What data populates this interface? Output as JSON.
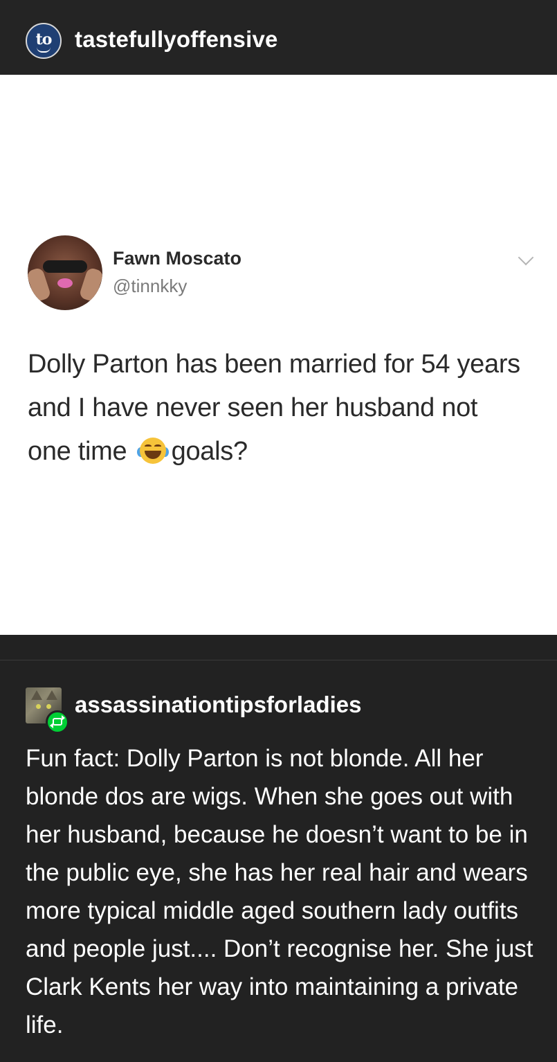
{
  "header": {
    "avatar_text": "to",
    "blog_name": "tastefullyoffensive"
  },
  "tweet": {
    "display_name": "Fawn Moscato",
    "handle": "@tinnkky",
    "text_before_emoji": "Dolly Parton has been married for 54 years and I have never seen her husband not one time",
    "emoji": "face-with-tears-of-joy",
    "text_after_emoji": "goals?"
  },
  "reblog": {
    "blog_name": "assassinationtipsforladies",
    "text": "Fun fact: Dolly Parton is not blonde. All her blonde dos are wigs. When she goes out with her husband, because he doesn’t want to be in the public eye, she has her real hair and wears more typical middle aged southern lady outfits and people just.... Don’t recognise her. She just Clark Kents her way into maintaining a private life."
  },
  "colors": {
    "background": "#222222",
    "header": "#242424",
    "reblog_green": "#00cf35",
    "avatar_blue": "#1f3f73"
  }
}
